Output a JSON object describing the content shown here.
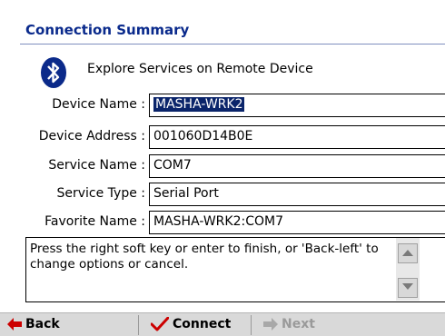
{
  "header": {
    "title": "Connection Summary"
  },
  "intro": {
    "text": "Explore Services on Remote Device",
    "icon": "bluetooth-icon"
  },
  "fields": [
    {
      "label": "Device Name :",
      "value": "MASHA-WRK2"
    },
    {
      "label": "Device Address :",
      "value": "001060D14B0E"
    },
    {
      "label": "Service Name :",
      "value": "COM7"
    },
    {
      "label": "Service Type :",
      "value": "Serial Port"
    },
    {
      "label": "Favorite Name :",
      "value": "MASHA-WRK2:COM7"
    }
  ],
  "info": {
    "text": "Press the right soft key or enter to finish, or 'Back-left' to change options or cancel."
  },
  "softkeys": {
    "back": "Back",
    "connect": "Connect",
    "next": "Next"
  },
  "colors": {
    "title": "#0a2a8c",
    "selection": "#0a246a",
    "softbar": "#d9d9d9",
    "connect_check": "#cc0000",
    "back_arrow": "#cc0000"
  }
}
